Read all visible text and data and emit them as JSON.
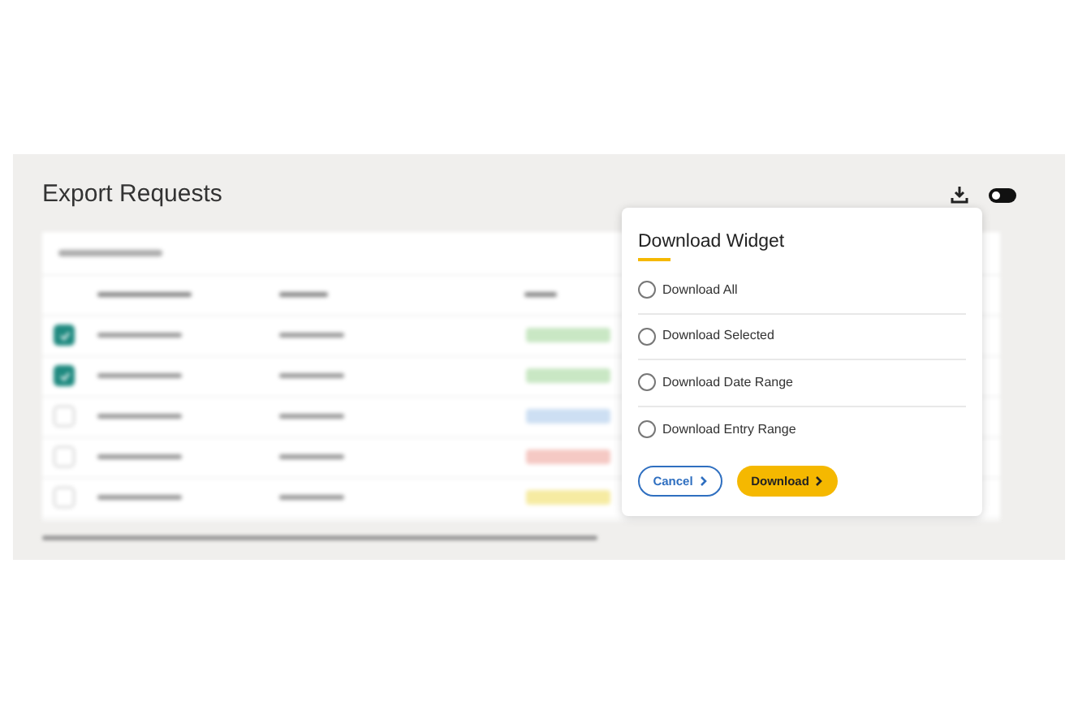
{
  "page": {
    "title": "Export Requests"
  },
  "toggle": {
    "on": false
  },
  "table": {
    "rows": [
      {
        "checked": true,
        "color": "#c9e7c4"
      },
      {
        "checked": true,
        "color": "#c9e7c4"
      },
      {
        "checked": false,
        "color": "#cddff3"
      },
      {
        "checked": false,
        "color": "#f5c9c4"
      },
      {
        "checked": false,
        "color": "#f6eba2"
      }
    ]
  },
  "dialog": {
    "title": "Download Widget",
    "options": [
      {
        "label": "Download All",
        "selected": false
      },
      {
        "label": "Download Selected",
        "selected": false
      },
      {
        "label": "Download Date Range",
        "selected": false
      },
      {
        "label": "Download Entry Range",
        "selected": false
      }
    ],
    "buttons": [
      {
        "kind": "secondary",
        "label": "Cancel"
      },
      {
        "kind": "primary",
        "label": "Download"
      }
    ]
  }
}
